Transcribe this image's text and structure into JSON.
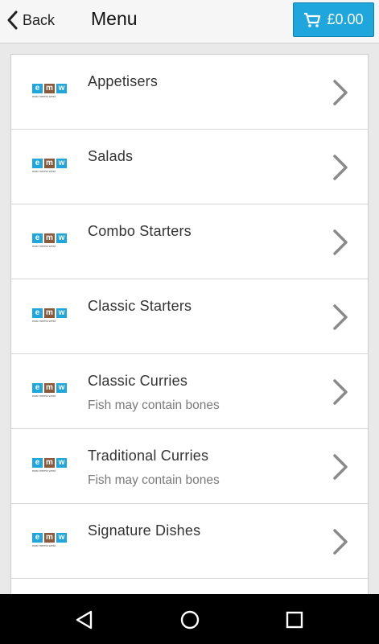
{
  "header": {
    "back_label": "Back",
    "title": "Menu",
    "cart_total": "£0.00"
  },
  "menu": {
    "logo": {
      "letters": [
        "e",
        "m",
        "w"
      ],
      "tagline": "east meets west"
    },
    "items": [
      {
        "label": "Appetisers",
        "note": ""
      },
      {
        "label": "Salads",
        "note": ""
      },
      {
        "label": "Combo Starters",
        "note": ""
      },
      {
        "label": "Classic Starters",
        "note": ""
      },
      {
        "label": "Classic Curries",
        "note": "Fish may contain bones"
      },
      {
        "label": "Traditional Curries",
        "note": "Fish may contain bones"
      },
      {
        "label": "Signature Dishes",
        "note": ""
      }
    ]
  },
  "colors": {
    "accent": "#1fa6dd",
    "logo_e": "#1fa6dd",
    "logo_m": "#8a5a3c",
    "logo_w": "#1fa6dd"
  },
  "icons": {
    "back": "chevron-left-icon",
    "cart": "cart-icon",
    "row": "chevron-right-icon",
    "nav": [
      "back-triangle-icon",
      "home-circle-icon",
      "recents-square-icon"
    ]
  }
}
